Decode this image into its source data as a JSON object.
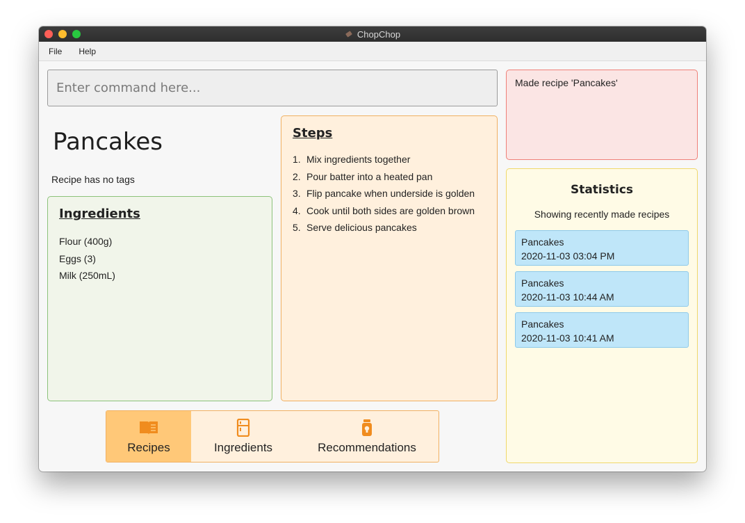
{
  "window": {
    "title": "ChopChop"
  },
  "menu": {
    "items": [
      "File",
      "Help"
    ]
  },
  "command": {
    "placeholder": "Enter command here..."
  },
  "recipe": {
    "name": "Pancakes",
    "tags_text": "Recipe has no tags",
    "ingredients_heading": "Ingredients",
    "ingredients": [
      "Flour (400g)",
      "Eggs (3)",
      "Milk (250mL)"
    ],
    "steps_heading": "Steps",
    "steps": [
      {
        "num": "1.",
        "text": "Mix ingredients together"
      },
      {
        "num": "2.",
        "text": "Pour batter into a heated pan"
      },
      {
        "num": "3.",
        "text": "Flip pancake when underside is golden"
      },
      {
        "num": "4.",
        "text": "Cook until both sides are golden brown"
      },
      {
        "num": "5.",
        "text": "Serve delicious pancakes"
      }
    ]
  },
  "message": {
    "text": "Made recipe 'Pancakes'"
  },
  "statistics": {
    "title": "Statistics",
    "subtitle": "Showing recently made recipes",
    "items": [
      {
        "name": "Pancakes",
        "time": "2020-11-03 03:04 PM"
      },
      {
        "name": "Pancakes",
        "time": "2020-11-03 10:44 AM"
      },
      {
        "name": "Pancakes",
        "time": "2020-11-03 10:41 AM"
      }
    ]
  },
  "tabs": [
    {
      "label": "Recipes",
      "icon": "book-icon",
      "active": true
    },
    {
      "label": "Ingredients",
      "icon": "fridge-icon",
      "active": false
    },
    {
      "label": "Recommendations",
      "icon": "jar-icon",
      "active": false
    }
  ],
  "colors": {
    "accent": "#f08c1e",
    "active_tab": "#ffc878",
    "stat_item": "#bfe6f9",
    "message_bg": "#fbe5e4",
    "ingredients_bg": "#f1f5ea",
    "steps_bg": "#fff0dd"
  }
}
